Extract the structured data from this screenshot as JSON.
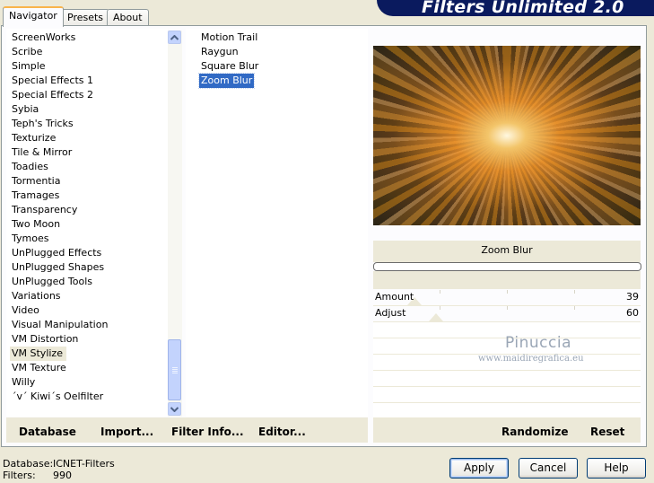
{
  "tabs": [
    {
      "label": "Navigator"
    },
    {
      "label": "Presets"
    },
    {
      "label": "About"
    }
  ],
  "title": "Filters Unlimited 2.0",
  "categories": [
    "ScreenWorks",
    "Scribe",
    "Simple",
    "Special Effects 1",
    "Special Effects 2",
    "Sybia",
    "Teph's Tricks",
    "Texturize",
    "Tile & Mirror",
    "Toadies",
    "Tormentia",
    "Tramages",
    "Transparency",
    "Two Moon",
    "Tymoes",
    "UnPlugged Effects",
    "UnPlugged Shapes",
    "UnPlugged Tools",
    "Variations",
    "Video",
    "Visual Manipulation",
    "VM Distortion",
    "VM Stylize",
    "VM Texture",
    "Willy",
    "´v´ Kiwi´s Oelfilter"
  ],
  "selected_category": "VM Stylize",
  "filters": [
    "Motion Trail",
    "Raygun",
    "Square Blur",
    "Zoom Blur"
  ],
  "selected_filter": "Zoom Blur",
  "preview": {
    "filter_name": "Zoom Blur"
  },
  "params": [
    {
      "label": "Amount",
      "value": "39"
    },
    {
      "label": "Adjust",
      "value": "60"
    }
  ],
  "watermark": {
    "name": "Pinuccia",
    "url": "www.maidiregrafica.eu"
  },
  "toolbar": {
    "database": "Database",
    "import": "Import...",
    "filter_info": "Filter Info...",
    "editor": "Editor...",
    "randomize": "Randomize",
    "reset": "Reset"
  },
  "status": {
    "database_label": "Database:",
    "database_value": "ICNET-Filters",
    "filters_label": "Filters:",
    "filters_value": "990"
  },
  "buttons": {
    "apply": "Apply",
    "cancel": "Cancel",
    "help": "Help"
  },
  "colors": {
    "selection": "#316ac5",
    "banner": "#0a1a5e",
    "face": "#ece9d8"
  }
}
